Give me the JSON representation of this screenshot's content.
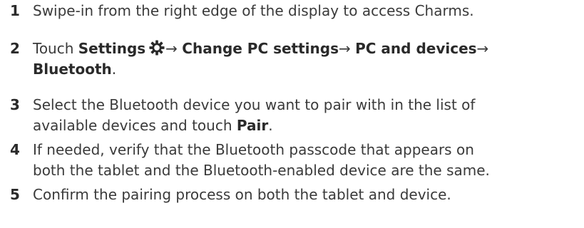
{
  "steps": [
    {
      "number": "1",
      "text": "Swipe-in from the right edge of the display to access Charms."
    },
    {
      "number": "2",
      "prefix": "Touch ",
      "settings": "Settings",
      "arrow": "→",
      "change_pc_settings": "Change PC settings",
      "pc_and_devices": "PC and devices",
      "bluetooth": "Bluetooth",
      "suffix": ".",
      "icon": "gear-icon"
    },
    {
      "number": "3",
      "line1": "Select the Bluetooth device you want to pair with in the list of",
      "line2_prefix": "available devices and touch ",
      "pair": "Pair",
      "line2_suffix": "."
    },
    {
      "number": "4",
      "line1": "If needed, verify that the Bluetooth passcode that appears on",
      "line2": "both the tablet and the Bluetooth-enabled device are the same."
    },
    {
      "number": "5",
      "text": "Confirm the pairing process on both the tablet and device."
    }
  ],
  "colors": {
    "text": "#3a3a3a",
    "emphasis": "#2a2a2a",
    "background": "#ffffff"
  }
}
